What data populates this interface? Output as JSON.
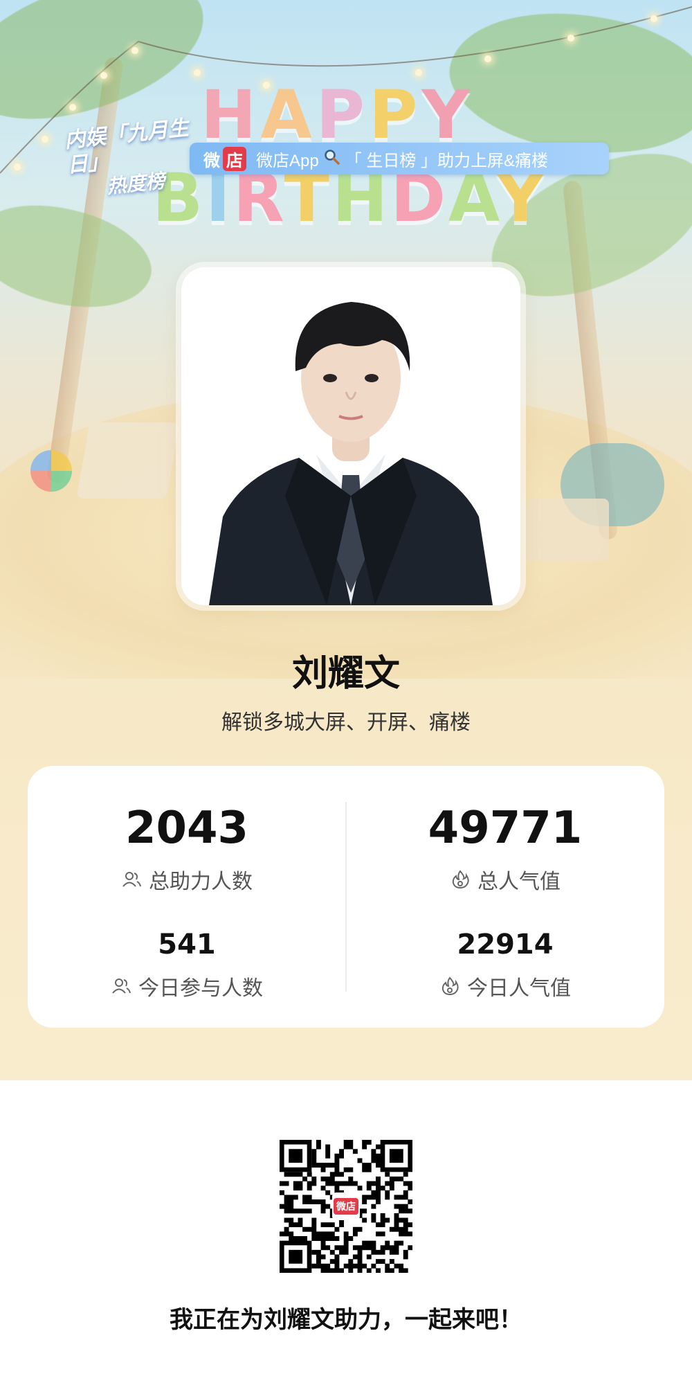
{
  "event": {
    "logo_line1": "内娱「九月生日」",
    "logo_line2": "热度榜",
    "greeting_line1": "HAPPY",
    "greeting_line2": "BIRTHDAY"
  },
  "banner": {
    "brand": "微",
    "brand_badge": "店",
    "text": "微店App",
    "search_icon": "magnifier-icon",
    "keyword": "「 生日榜 」助力上屏&痛楼"
  },
  "profile": {
    "name": "刘耀文",
    "subtitle": "解锁多城大屏、开屏、痛楼"
  },
  "stats": {
    "total_supporters_value": "2043",
    "total_supporters_label": "总助力人数",
    "total_popularity_value": "49771",
    "total_popularity_label": "总人气值",
    "today_participants_value": "541",
    "today_participants_label": "今日参与人数",
    "today_popularity_value": "22914",
    "today_popularity_label": "今日人气值",
    "people_icon": "people-icon",
    "flame_icon": "flame-icon"
  },
  "footer": {
    "qr_center_label": "微店",
    "cta": "我正在为刘耀文助力，一起来吧！"
  },
  "colors": {
    "banner": "#8cc2f7",
    "badge_red": "#e23b4a",
    "card_bg": "#ffffff"
  }
}
